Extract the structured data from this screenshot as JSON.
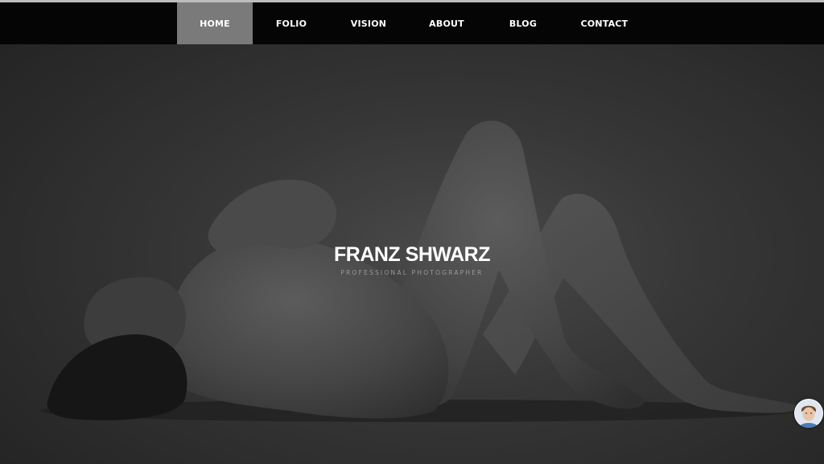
{
  "nav": {
    "items": [
      {
        "label": "HOME",
        "active": true
      },
      {
        "label": "FOLIO",
        "active": false
      },
      {
        "label": "VISION",
        "active": false
      },
      {
        "label": "ABOUT",
        "active": false
      },
      {
        "label": "BLOG",
        "active": false
      },
      {
        "label": "CONTACT",
        "active": false
      }
    ]
  },
  "hero": {
    "title": "FRANZ SHWARZ",
    "subtitle": "PROFESSIONAL PHOTOGRAPHER"
  },
  "colors": {
    "nav_background": "#050505",
    "nav_active": "#7a7a7a",
    "title_text": "#ffffff",
    "subtitle_text": "#9a9a9a"
  },
  "icons": {
    "avatar": "user-avatar-icon"
  }
}
